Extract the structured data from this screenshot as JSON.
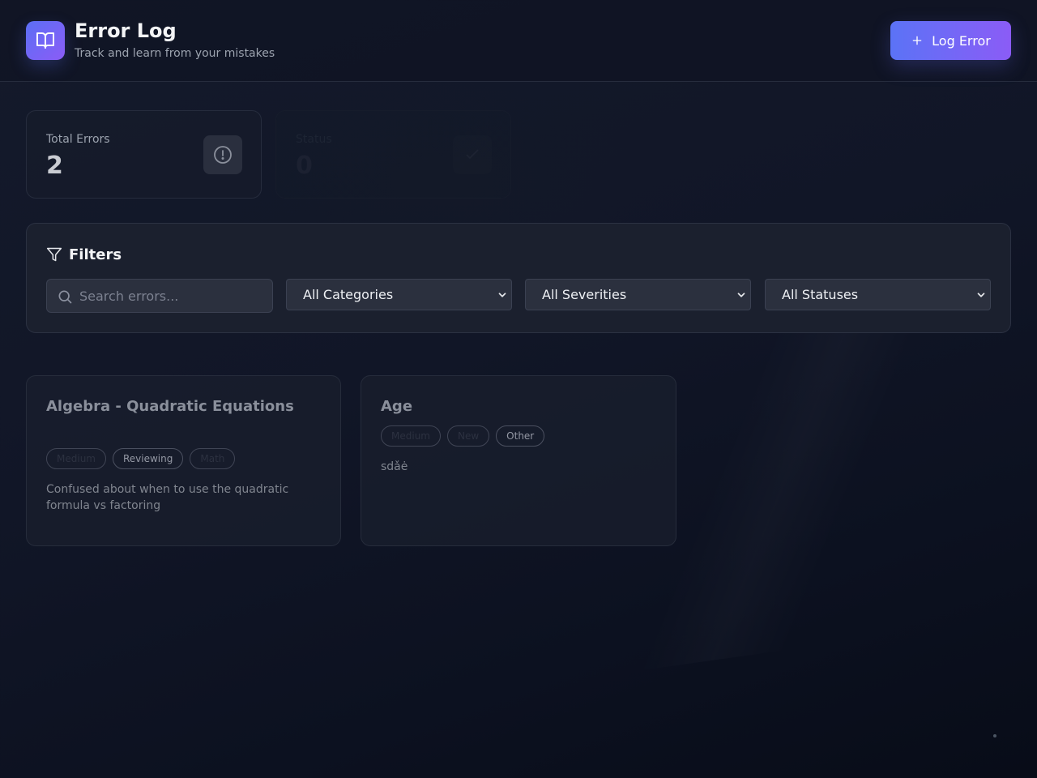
{
  "header": {
    "title": "Error Log",
    "subtitle": "Track and learn from your mistakes",
    "log_button_label": "Log Error",
    "logo_icon": "book-open-icon",
    "accent_gradient": [
      "#5b73f6",
      "#8b5cf6"
    ]
  },
  "stats": [
    {
      "label": "Total Errors",
      "value": "2",
      "icon": "alert-circle-icon"
    },
    {
      "label": "Status",
      "value": "0",
      "icon": "check-icon"
    }
  ],
  "filters": {
    "title": "Filters",
    "search_placeholder": "Search errors...",
    "category_selected": "All Categories",
    "severity_selected": "All Severities",
    "status_selected": "All Statuses"
  },
  "errors": [
    {
      "title": "Algebra - Quadratic Equations",
      "tags": [
        "Medium",
        "Reviewing",
        "Math"
      ],
      "description": "Confused about when to use the quadratic formula vs factoring"
    },
    {
      "title": "Age",
      "tags": [
        "Medium",
        "New",
        "Other"
      ],
      "description": "sdǎė"
    }
  ]
}
